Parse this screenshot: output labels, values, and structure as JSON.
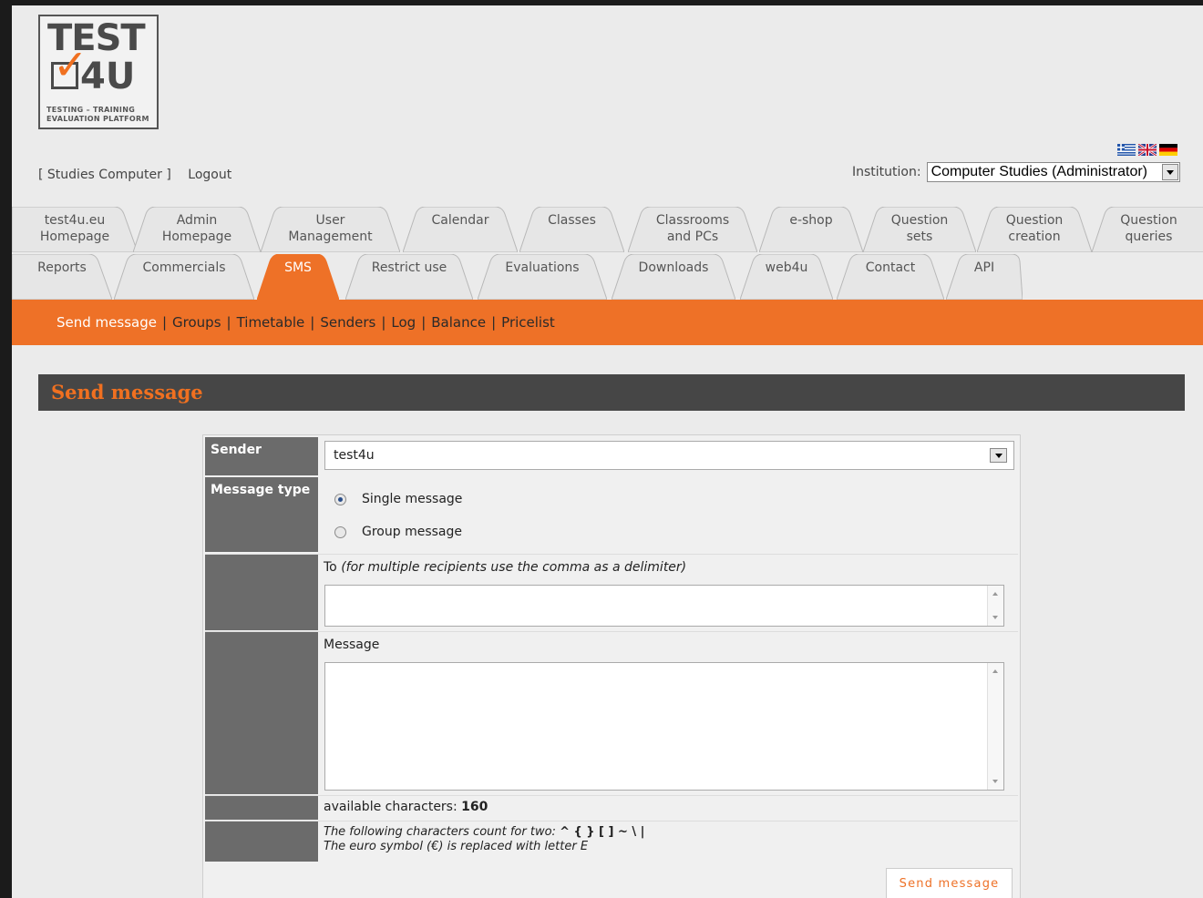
{
  "logo": {
    "line1": "TEST",
    "line2": "4U",
    "tagline1": "TESTING  –  TRAINING",
    "tagline2": "EVALUATION PLATFORM"
  },
  "top_links": {
    "studies": "[ Studies Computer ]",
    "logout": "Logout"
  },
  "languages": [
    "greek-flag-icon",
    "uk-flag-icon",
    "german-flag-icon"
  ],
  "institution": {
    "label": "Institution:",
    "value": "Computer Studies (Administrator)"
  },
  "tabs_row1": [
    {
      "line1": "test4u.eu",
      "line2": "Homepage"
    },
    {
      "line1": "Admin",
      "line2": "Homepage"
    },
    {
      "line1": "User",
      "line2": "Management"
    },
    {
      "line1": "Calendar",
      "line2": ""
    },
    {
      "line1": "Classes",
      "line2": ""
    },
    {
      "line1": "Classrooms",
      "line2": "and PCs"
    },
    {
      "line1": "e-shop",
      "line2": ""
    },
    {
      "line1": "Question",
      "line2": "sets"
    },
    {
      "line1": "Question",
      "line2": "creation"
    },
    {
      "line1": "Question",
      "line2": "queries"
    }
  ],
  "tabs_row2": [
    {
      "line1": "Reports"
    },
    {
      "line1": "Commercials"
    },
    {
      "line1": "SMS",
      "active": true
    },
    {
      "line1": "Restrict use"
    },
    {
      "line1": "Evaluations"
    },
    {
      "line1": "Downloads"
    },
    {
      "line1": "web4u"
    },
    {
      "line1": "Contact"
    },
    {
      "line1": "API"
    }
  ],
  "subnav": [
    "Send message",
    "Groups",
    "Timetable",
    "Senders",
    "Log",
    "Balance",
    "Pricelist"
  ],
  "section_title": "Send message",
  "form": {
    "sender_label": "Sender",
    "sender_value": "test4u",
    "message_type_label": "Message type",
    "single_message": "Single message",
    "group_message": "Group message",
    "to_label": "To",
    "to_hint": "(for multiple recipients use the comma as a delimiter)",
    "message_label": "Message",
    "available_label": "available characters:",
    "available_count": "160",
    "note_line1": "The following characters count for two:",
    "note_chars": "^ { } [ ] ~ \\ |",
    "note_line2": "The euro symbol (€) is replaced with letter E",
    "send_button": "Send message"
  },
  "colors": {
    "accent": "#ee7127",
    "dark": "#464646",
    "label_bg": "#6b6b6b",
    "page_bg": "#ebebeb"
  }
}
